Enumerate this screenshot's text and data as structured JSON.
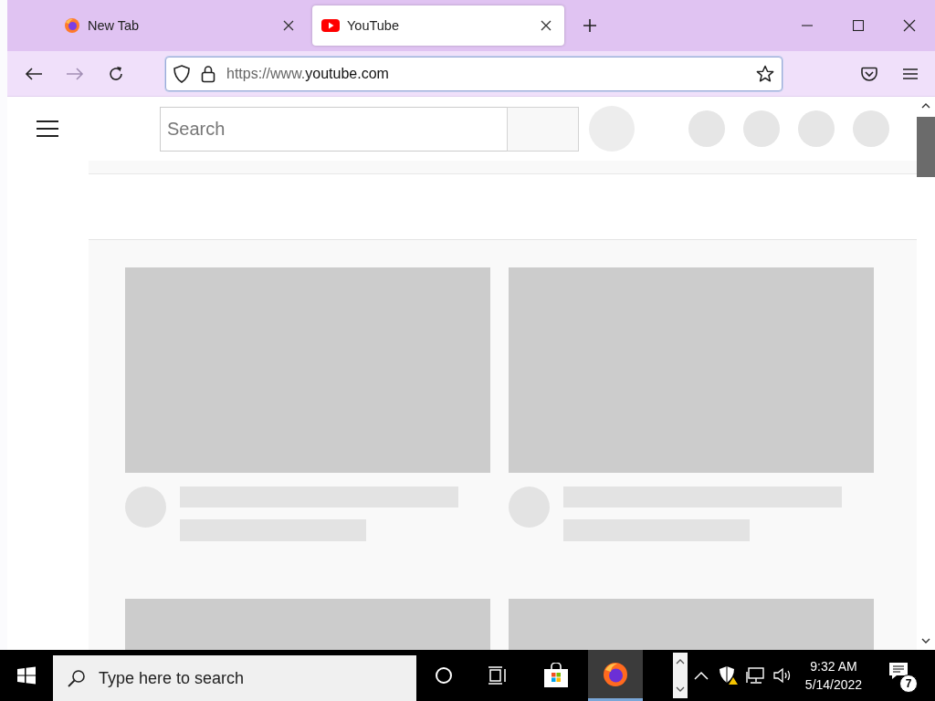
{
  "tabs": [
    {
      "title": "New Tab",
      "kind": "firefox",
      "selected": false
    },
    {
      "title": "YouTube",
      "kind": "youtube",
      "selected": true
    }
  ],
  "address_bar": {
    "url_prefix": "https://www.",
    "url_domain": "youtube.com"
  },
  "page": {
    "search": {
      "placeholder": "Search"
    },
    "video_placeholders": [
      {
        "kind": "skeleton"
      },
      {
        "kind": "skeleton"
      },
      {
        "kind": "skeleton"
      },
      {
        "kind": "skeleton"
      }
    ]
  },
  "taskbar": {
    "search": {
      "placeholder": "Type here to search"
    },
    "apps": [
      {
        "kind": "store",
        "selected": false
      },
      {
        "kind": "firefox",
        "selected": true
      }
    ],
    "time": "9:32 AM",
    "date": "5/14/2022",
    "notifications": "7"
  }
}
